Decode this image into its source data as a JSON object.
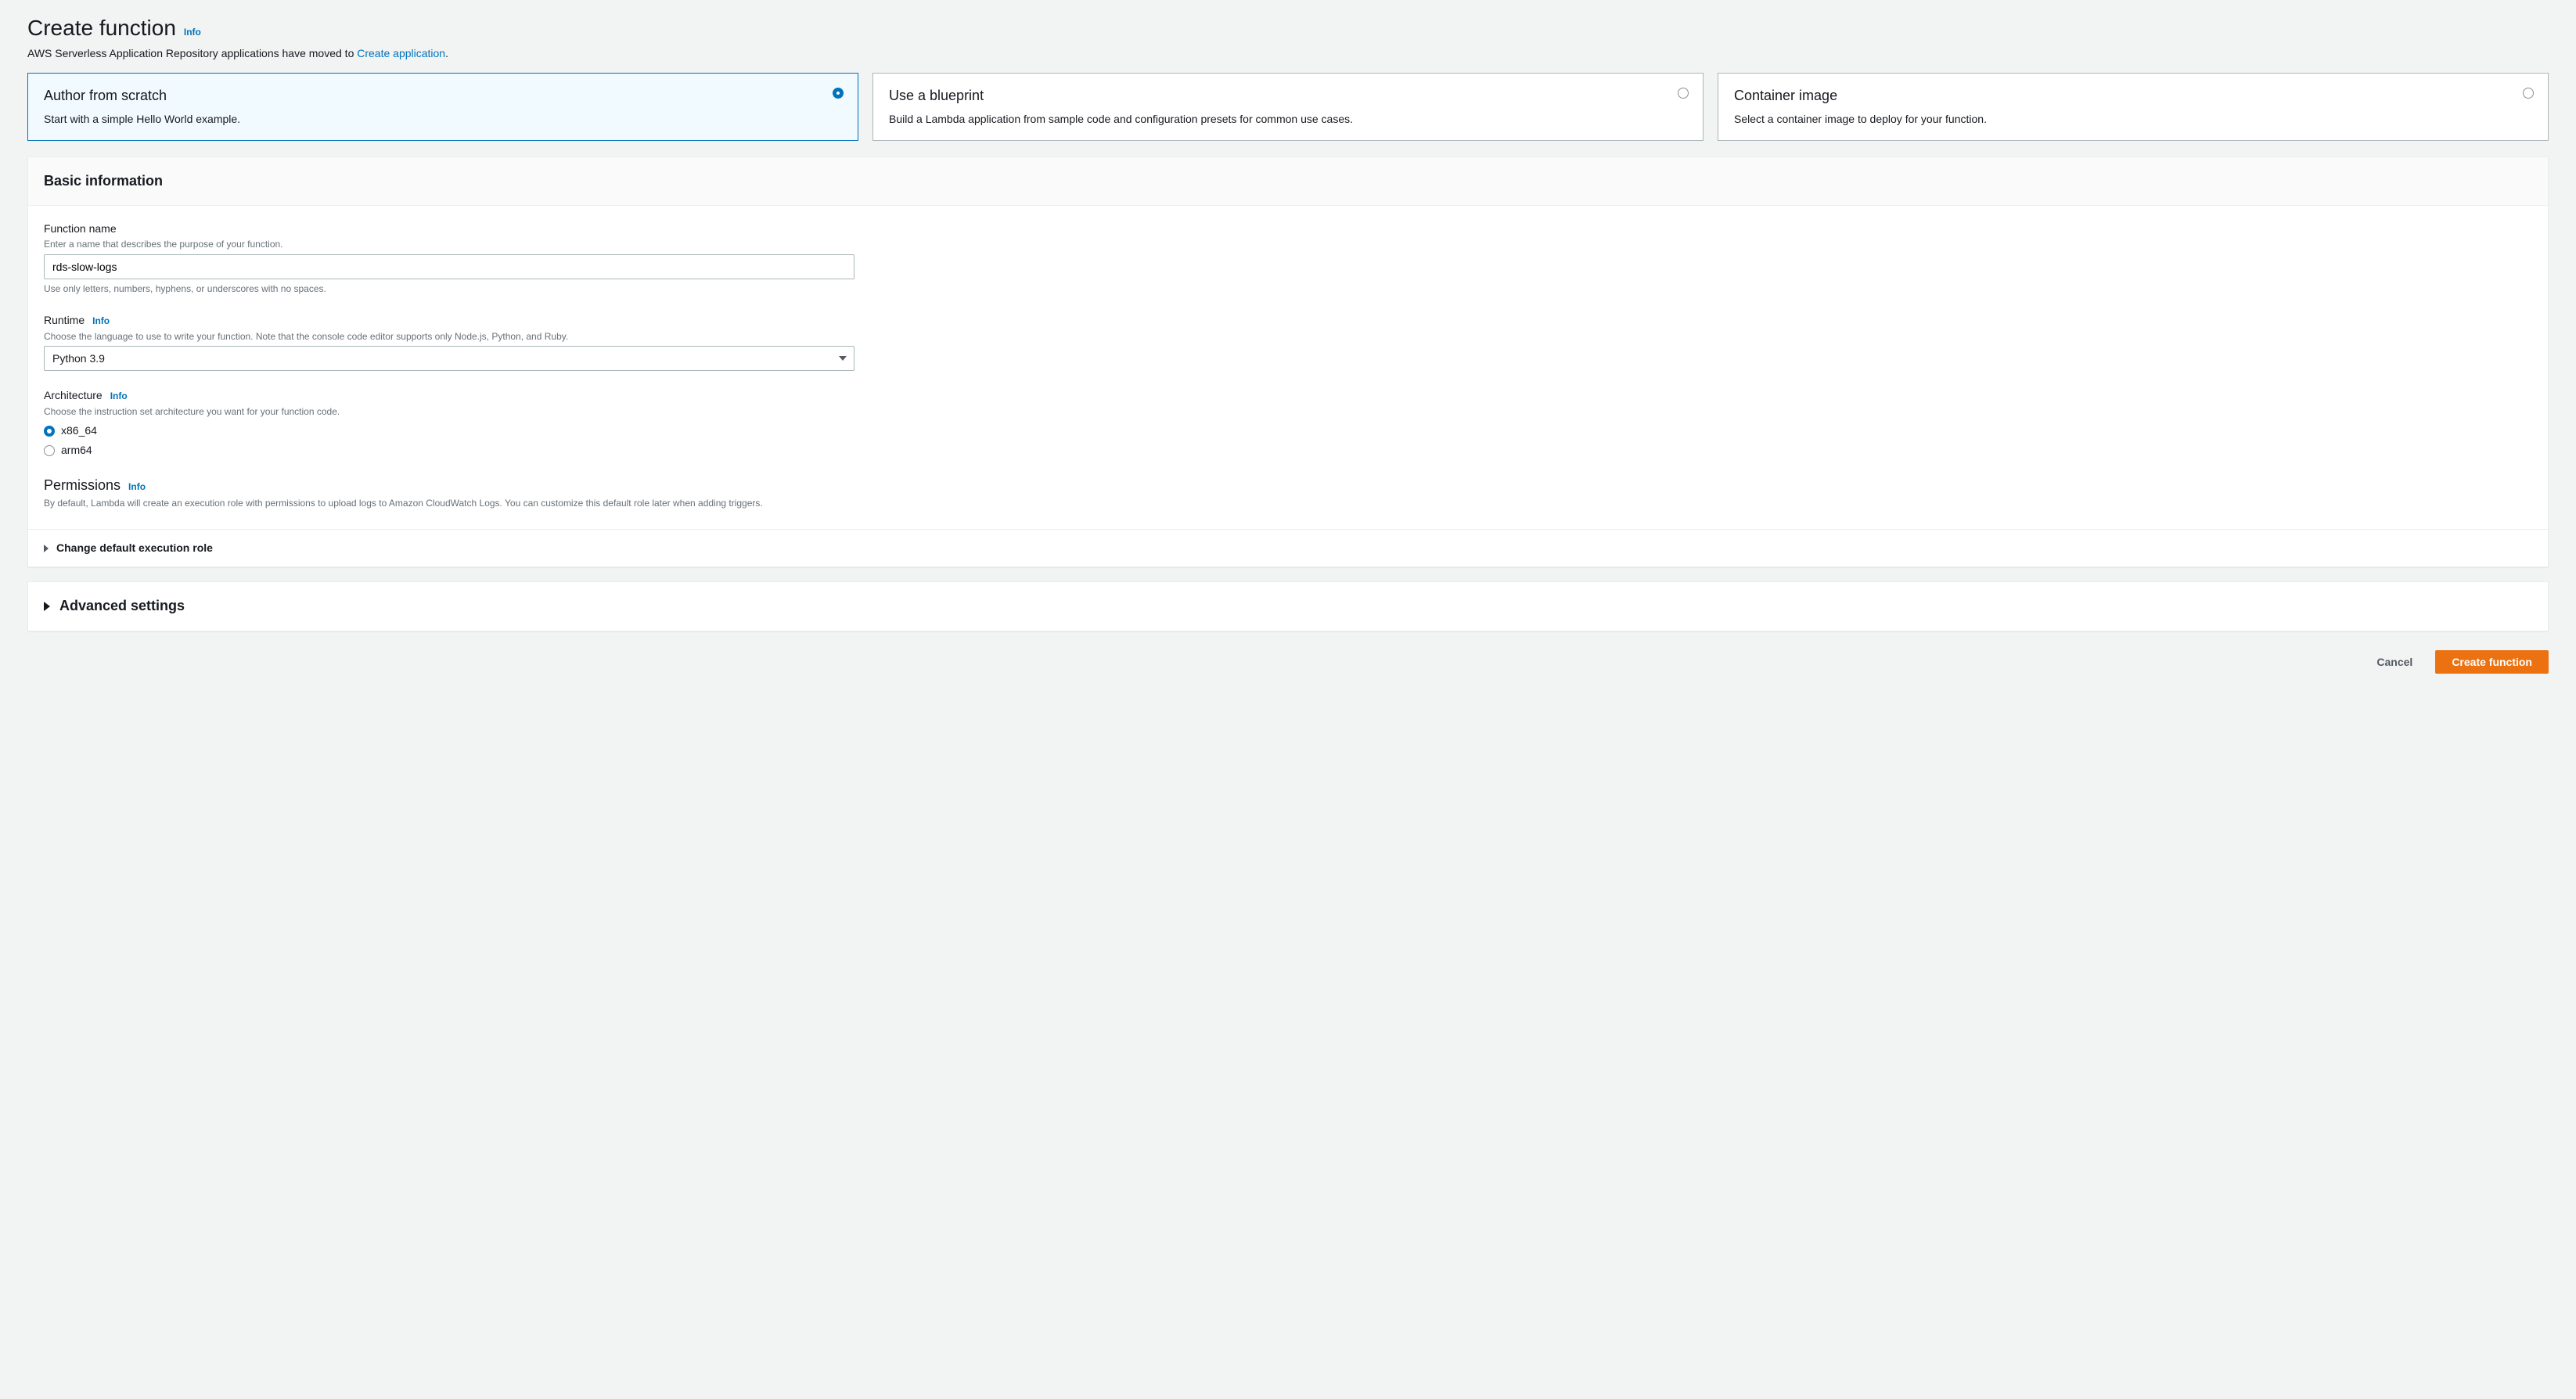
{
  "header": {
    "title": "Create function",
    "info_label": "Info",
    "subtext_prefix": "AWS Serverless Application Repository applications have moved to ",
    "subtext_link": "Create application",
    "subtext_suffix": "."
  },
  "options": [
    {
      "title": "Author from scratch",
      "desc": "Start with a simple Hello World example.",
      "selected": true
    },
    {
      "title": "Use a blueprint",
      "desc": "Build a Lambda application from sample code and configuration presets for common use cases.",
      "selected": false
    },
    {
      "title": "Container image",
      "desc": "Select a container image to deploy for your function.",
      "selected": false
    }
  ],
  "basic": {
    "heading": "Basic information",
    "function_name": {
      "label": "Function name",
      "hint": "Enter a name that describes the purpose of your function.",
      "value": "rds-slow-logs",
      "help": "Use only letters, numbers, hyphens, or underscores with no spaces."
    },
    "runtime": {
      "label": "Runtime",
      "info": "Info",
      "hint": "Choose the language to use to write your function. Note that the console code editor supports only Node.js, Python, and Ruby.",
      "value": "Python 3.9"
    },
    "architecture": {
      "label": "Architecture",
      "info": "Info",
      "hint": "Choose the instruction set architecture you want for your function code.",
      "options": [
        {
          "label": "x86_64",
          "checked": true
        },
        {
          "label": "arm64",
          "checked": false
        }
      ]
    },
    "permissions": {
      "label": "Permissions",
      "info": "Info",
      "hint": "By default, Lambda will create an execution role with permissions to upload logs to Amazon CloudWatch Logs. You can customize this default role later when adding triggers."
    },
    "execution_role_toggle": "Change default execution role"
  },
  "advanced": {
    "label": "Advanced settings"
  },
  "footer": {
    "cancel": "Cancel",
    "create": "Create function"
  }
}
